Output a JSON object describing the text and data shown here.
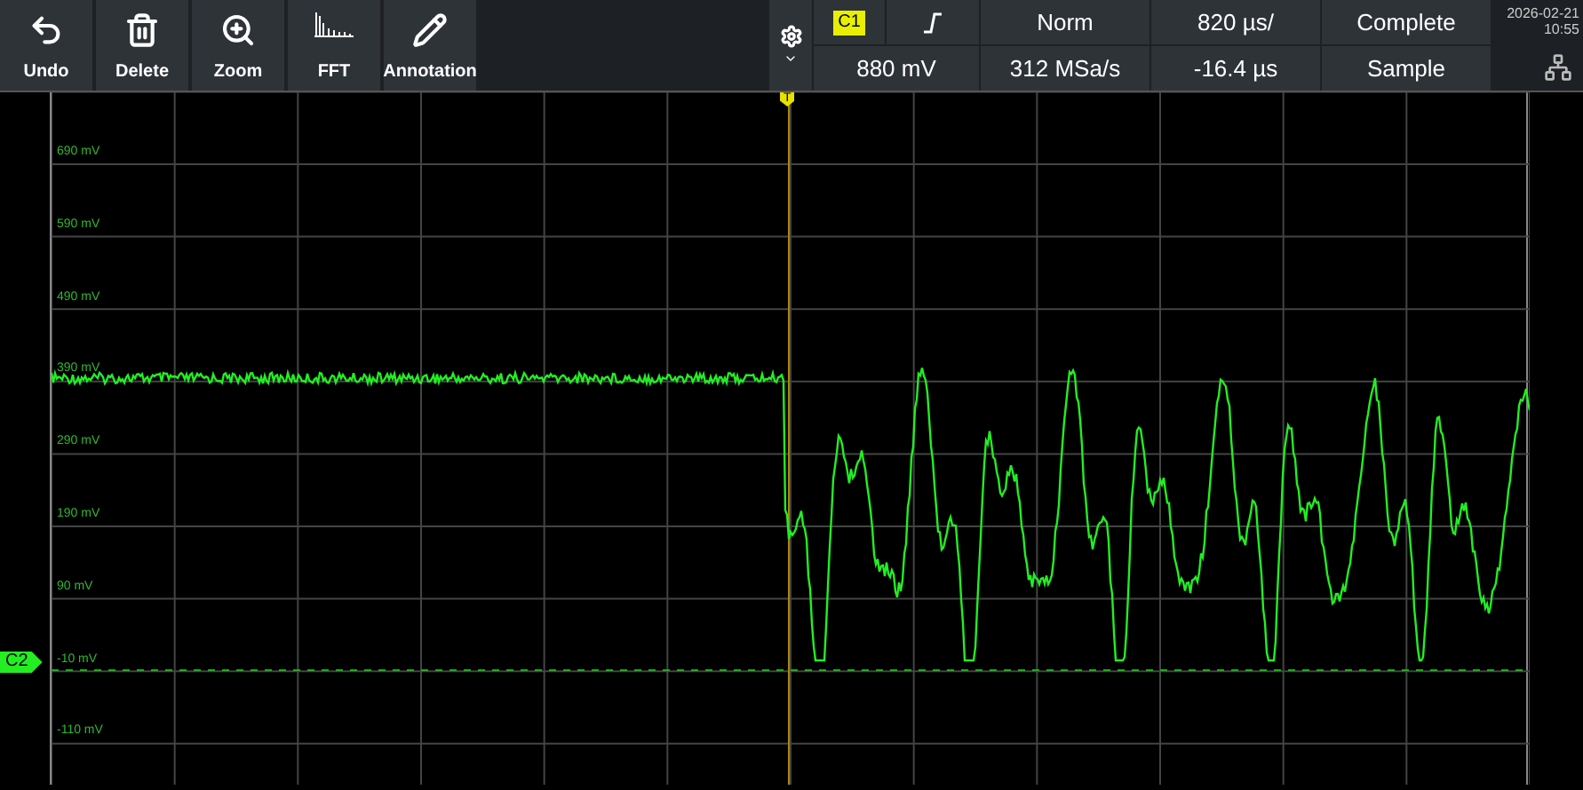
{
  "toolbar": [
    {
      "kind": "undo",
      "label": "Undo"
    },
    {
      "kind": "delete",
      "label": "Delete"
    },
    {
      "kind": "zoom",
      "label": "Zoom"
    },
    {
      "kind": "fft",
      "label": "FFT"
    },
    {
      "kind": "annotation",
      "label": "Annotation"
    }
  ],
  "status": {
    "channel": "C1",
    "trigger_mode": "Norm",
    "timebase": "820 µs/",
    "acquisition": "Complete",
    "trigger_level": "880 mV",
    "sample_rate": "312 MSa/s",
    "time_offset": "-16.4 µs",
    "acquire_mode": "Sample"
  },
  "clock": {
    "date": "2026-02-21",
    "time": "10:55"
  },
  "plot": {
    "y_labels": [
      "690 mV",
      "590 mV",
      "490 mV",
      "390 mV",
      "290 mV",
      "190 mV",
      "90 mV",
      "-10 mV",
      "-110 mV"
    ],
    "channel_marker": "C2",
    "trigger_marker": "T"
  }
}
